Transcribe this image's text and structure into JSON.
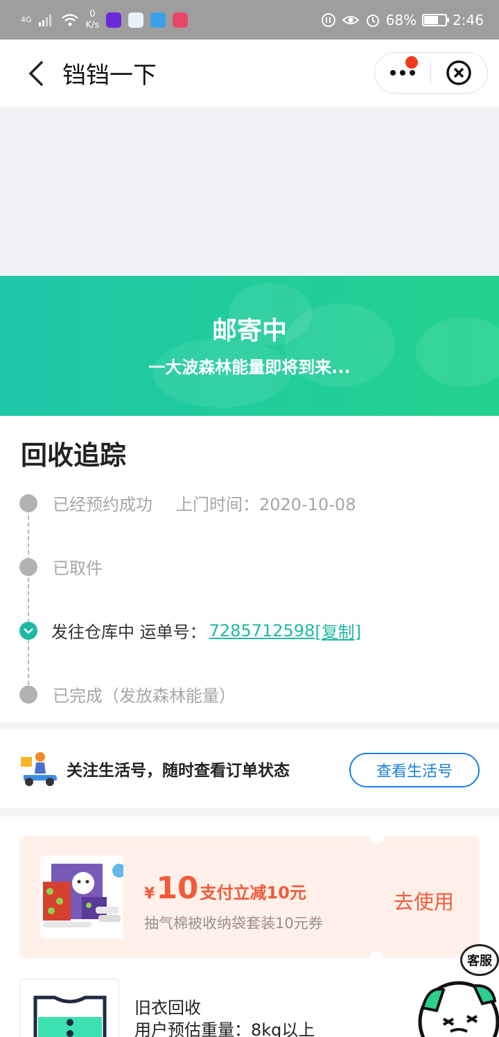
{
  "status_bar": {
    "signal": "4G",
    "speed_value": "0",
    "speed_unit": "K/s",
    "battery": "68%",
    "battery_level": 0.68,
    "time": "2:46"
  },
  "nav": {
    "title": "铛铛一下"
  },
  "banner": {
    "title": "邮寄中",
    "subtitle": "一大波森林能量即将到来..."
  },
  "tracking": {
    "title": "回收追踪",
    "steps": [
      {
        "label": "已经预约成功",
        "extra": "上门时间：2020-10-08"
      },
      {
        "label": "已取件"
      },
      {
        "label": "发往仓库中 运单号：",
        "tracking_no": "7285712598",
        "copy_label": "[复制]"
      },
      {
        "label": "已完成（发放森林能量）"
      }
    ]
  },
  "follow": {
    "text": "关注生活号，随时查看订单状态",
    "button": "查看生活号"
  },
  "coupon": {
    "currency": "¥",
    "amount": "10",
    "desc": "支付立减10元",
    "subtitle": "抽气棉被收纳袋套装10元券",
    "action": "去使用",
    "bg_color": "#fff1ea",
    "accent_color": "#f25a3a"
  },
  "item": {
    "name": "旧衣回收",
    "weight_label": "用户预估重量：8kg以上"
  },
  "service": {
    "label": "客服"
  },
  "colors": {
    "brand_green": "#1fb8a2",
    "link_blue": "#1a7fe0"
  }
}
